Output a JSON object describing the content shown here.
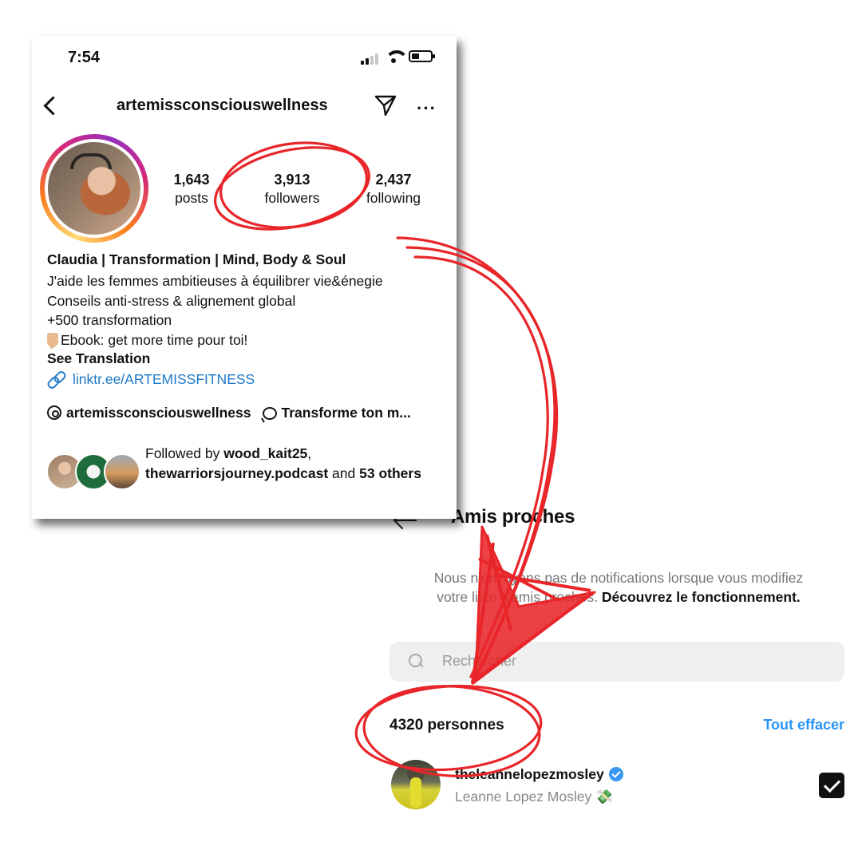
{
  "profile": {
    "status_bar": {
      "time": "7:54"
    },
    "header": {
      "username": "artemissconsciouswellness"
    },
    "stats": [
      {
        "value": "1,643",
        "label": "posts"
      },
      {
        "value": "3,913",
        "label": "followers"
      },
      {
        "value": "2,437",
        "label": "following"
      }
    ],
    "bio": {
      "name": "Claudia | Transformation | Mind, Body & Soul",
      "line1": "J'aide les femmes ambitieuses à équilibrer vie&énegie",
      "line2": "Conseils anti-stress & alignement global",
      "line3": "+500 transformation",
      "line4": "Ebook: get more time pour toi!",
      "see_translation": "See Translation",
      "link": "linktr.ee/ARTEMISSFITNESS"
    },
    "threads_handle": "artemissconsciouswellness",
    "threads_channel": "Transforme ton m...",
    "followed_by": {
      "prefix": "Followed by ",
      "user1": "wood_kait25",
      "separator": ",",
      "user2": "thewarriorsjourney.podcast",
      "and": " and ",
      "count": "53",
      "others": "others"
    }
  },
  "close_friends": {
    "title": "Amis proches",
    "info_text": "Nous n'envoyons pas de notifications lorsque vous modifiez votre liste d'amis proches.",
    "info_link": "Découvrez le fonctionnement.",
    "search_placeholder": "Rechercher",
    "count_label": "4320 personnes",
    "clear_all": "Tout effacer",
    "list": [
      {
        "username": "theleannelopezmosley",
        "full_name": "Leanne Lopez Mosley 💸",
        "verified": true,
        "checked": true
      }
    ]
  },
  "colors": {
    "annotation_red": "#e8262a",
    "link_blue": "#2b95f5",
    "verified_blue": "#3897f0"
  }
}
